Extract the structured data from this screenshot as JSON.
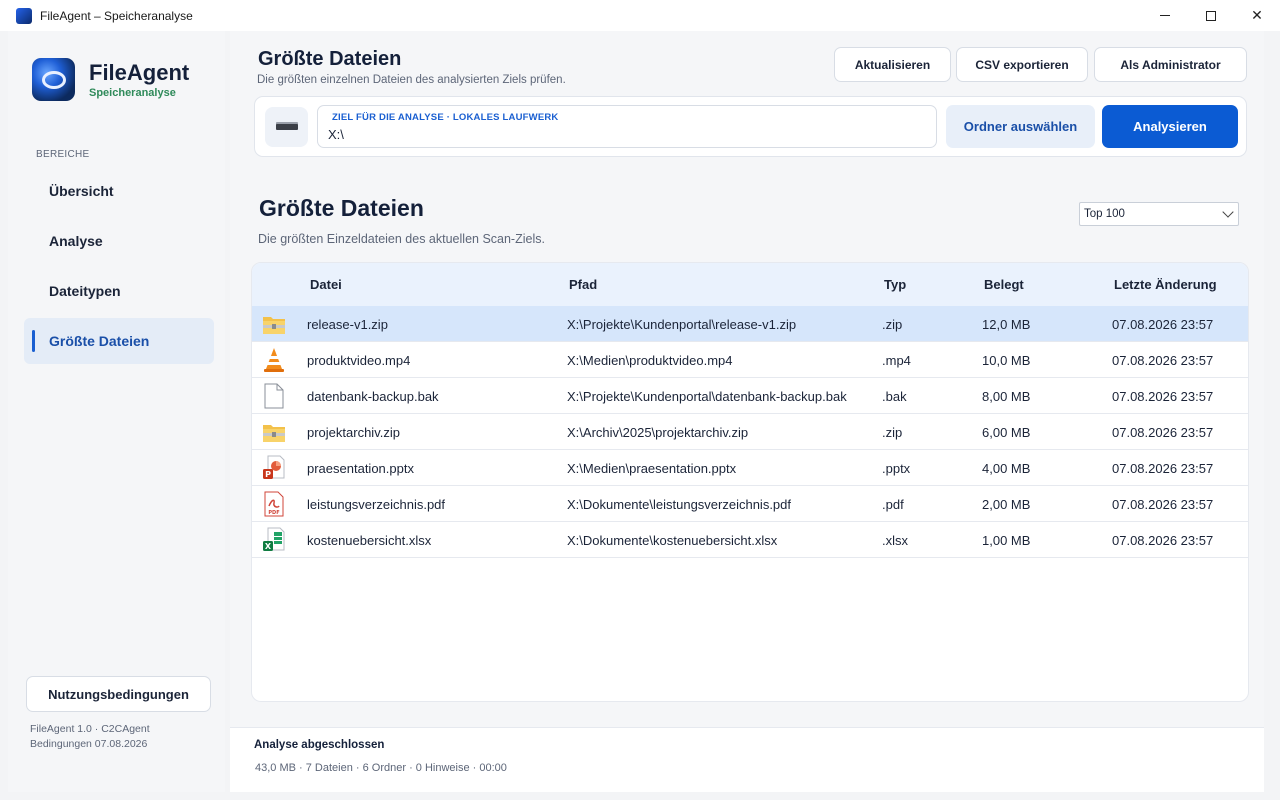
{
  "window": {
    "title": "FileAgent – Speicheranalyse",
    "minimize": "—",
    "maximize": "☐",
    "close": "✕"
  },
  "sidebar": {
    "app_name": "FileAgent",
    "app_subtitle": "Speicheranalyse",
    "section_label": "BEREICHE",
    "items": [
      {
        "label": "Übersicht",
        "active": false
      },
      {
        "label": "Analyse",
        "active": false
      },
      {
        "label": "Dateitypen",
        "active": false
      },
      {
        "label": "Größte Dateien",
        "active": true
      }
    ],
    "terms_button": "Nutzungsbedingungen",
    "version_line1": "FileAgent 1.0 · C2CAgent",
    "version_line2": "Bedingungen 07.08.2026"
  },
  "header": {
    "title": "Größte Dateien",
    "subtitle": "Die größten einzelnen Dateien des analysierten Ziels prüfen.",
    "refresh_button": "Aktualisieren",
    "export_button": "CSV exportieren",
    "admin_button": "Als Administrator"
  },
  "target": {
    "label": "ZIEL FÜR DIE ANALYSE  ·  LOKALES LAUFWERK",
    "value": "X:\\",
    "folder_button": "Ordner auswählen",
    "analyze_button": "Analysieren"
  },
  "section": {
    "title": "Größte Dateien",
    "subtitle": "Die größten Einzeldateien des aktuellen Scan-Ziels.",
    "topn_selected": "Top 100"
  },
  "table": {
    "headers": {
      "file": "Datei",
      "path": "Pfad",
      "type": "Typ",
      "size": "Belegt",
      "modified": "Letzte Änderung"
    },
    "rows": [
      {
        "icon": "zip-folder-icon",
        "name": "release-v1.zip",
        "path": "X:\\Projekte\\Kundenportal\\release-v1.zip",
        "type": ".zip",
        "size": "12,0 MB",
        "modified": "07.08.2026 23:57",
        "selected": true
      },
      {
        "icon": "vlc-cone-icon",
        "name": "produktvideo.mp4",
        "path": "X:\\Medien\\produktvideo.mp4",
        "type": ".mp4",
        "size": "10,0 MB",
        "modified": "07.08.2026 23:57",
        "selected": false
      },
      {
        "icon": "blank-file-icon",
        "name": "datenbank-backup.bak",
        "path": "X:\\Projekte\\Kundenportal\\datenbank-backup.bak",
        "type": ".bak",
        "size": "8,00 MB",
        "modified": "07.08.2026 23:57",
        "selected": false
      },
      {
        "icon": "zip-folder-icon",
        "name": "projektarchiv.zip",
        "path": "X:\\Archiv\\2025\\projektarchiv.zip",
        "type": ".zip",
        "size": "6,00 MB",
        "modified": "07.08.2026 23:57",
        "selected": false
      },
      {
        "icon": "powerpoint-icon",
        "name": "praesentation.pptx",
        "path": "X:\\Medien\\praesentation.pptx",
        "type": ".pptx",
        "size": "4,00 MB",
        "modified": "07.08.2026 23:57",
        "selected": false
      },
      {
        "icon": "pdf-icon",
        "name": "leistungsverzeichnis.pdf",
        "path": "X:\\Dokumente\\leistungsverzeichnis.pdf",
        "type": ".pdf",
        "size": "2,00 MB",
        "modified": "07.08.2026 23:57",
        "selected": false
      },
      {
        "icon": "excel-icon",
        "name": "kostenuebersicht.xlsx",
        "path": "X:\\Dokumente\\kostenuebersicht.xlsx",
        "type": ".xlsx",
        "size": "1,00 MB",
        "modified": "07.08.2026 23:57",
        "selected": false
      }
    ]
  },
  "status": {
    "title": "Analyse abgeschlossen",
    "info": "43,0 MB · 7 Dateien · 6 Ordner · 0 Hinweise · 00:00"
  },
  "colors": {
    "accent": "#0b5bd3",
    "brand_sub": "#2f8a5a",
    "selected_row": "#d6e6fb"
  }
}
